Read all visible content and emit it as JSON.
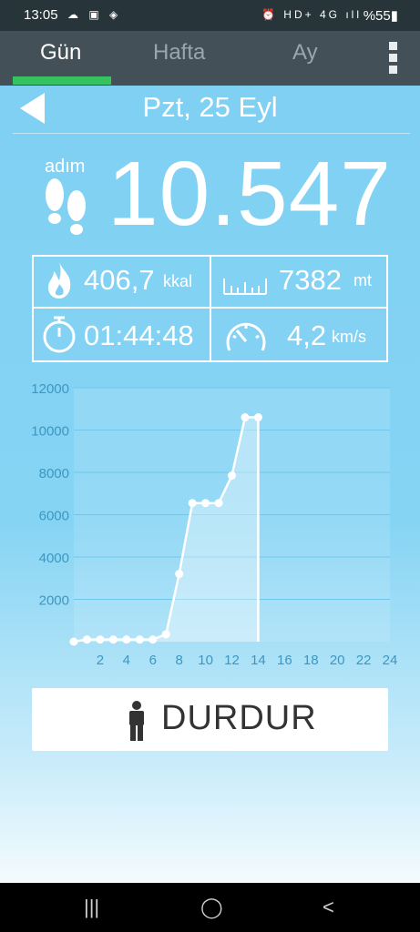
{
  "status_bar": {
    "time": "13:05",
    "left_icons": "☁ ▣ ◈",
    "right_icons": "⏰ HD+ 4G ıll",
    "battery": "%55▮"
  },
  "tabs": [
    {
      "label": "Gün"
    },
    {
      "label": "Hafta"
    },
    {
      "label": "Ay"
    }
  ],
  "header": {
    "date": "Pzt, 25 Eyl"
  },
  "steps": {
    "label": "adım",
    "value": "10.547"
  },
  "stats": {
    "calories": {
      "value": "406,7",
      "unit": "kkal"
    },
    "distance": {
      "value": "7382",
      "unit": "mt"
    },
    "duration": {
      "value": "01:44:48"
    },
    "speed": {
      "value": "4,2",
      "unit": "km/s"
    }
  },
  "chart_data": {
    "type": "line",
    "x": [
      0,
      1,
      2,
      3,
      4,
      5,
      6,
      7,
      8,
      9,
      10,
      11,
      12,
      13,
      14
    ],
    "values": [
      0,
      100,
      100,
      100,
      100,
      100,
      100,
      350,
      3200,
      6550,
      6550,
      6550,
      7850,
      10600,
      10600
    ],
    "xticks": [
      "2",
      "4",
      "6",
      "8",
      "10",
      "12",
      "14",
      "16",
      "18",
      "20",
      "22",
      "24"
    ],
    "yticks": [
      "2000",
      "4000",
      "6000",
      "8000",
      "10000",
      "12000"
    ],
    "xlim": [
      0,
      24
    ],
    "ylim": [
      0,
      12000
    ],
    "grid": true,
    "colors": {
      "line": "#ffffff",
      "grid": "#6fc8ec",
      "area": "rgba(255,255,255,0.35)",
      "axis_text": "#3d97c0"
    }
  },
  "stop_button": {
    "label": "DURDUR"
  },
  "nav": {
    "recents": "|||",
    "home": "◯",
    "back": "<"
  }
}
